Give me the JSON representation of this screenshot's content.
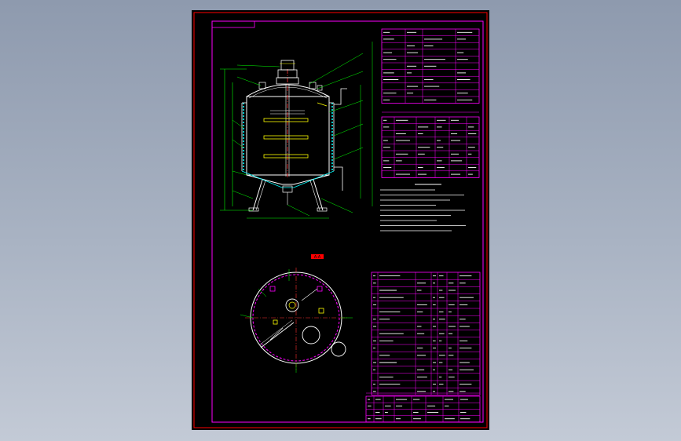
{
  "viewport": {
    "background_top": "#8e9aae",
    "background_bottom": "#c3cad6"
  },
  "drawing": {
    "background": "#000000",
    "colors": {
      "frame": "#ff00ff",
      "outline": "#ffffff",
      "center_line": "#ff3030",
      "dimension": "#00ffff",
      "hidden": "#ffff00",
      "leader": "#00ff00",
      "tag": "#ff0000"
    },
    "plan_view_tag": "A-A",
    "spec_table": {
      "rows": 11,
      "columns": 4
    },
    "parts_table": {
      "rows": 9,
      "columns": 6
    },
    "notes": {
      "lines": 9
    },
    "bom_table": {
      "rows": 17,
      "columns": 7
    },
    "title_block": {
      "rows": 4
    }
  }
}
